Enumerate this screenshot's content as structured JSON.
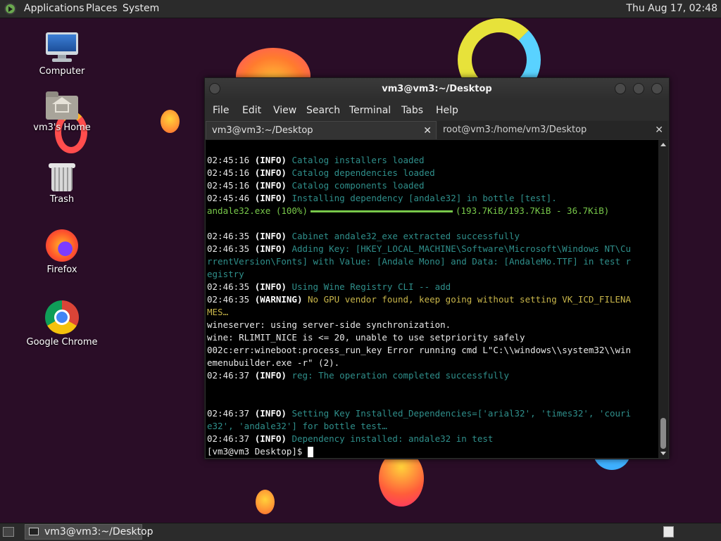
{
  "top_panel": {
    "menus": [
      "Applications",
      "Places",
      "System"
    ],
    "clock": "Thu Aug 17, 02:48"
  },
  "desktop": {
    "icons": [
      {
        "label": "Computer",
        "icon": "computer-icon"
      },
      {
        "label": "vm3's Home",
        "icon": "home-folder-icon"
      },
      {
        "label": "Trash",
        "icon": "trash-icon"
      },
      {
        "label": "Firefox",
        "icon": "firefox-icon"
      },
      {
        "label": "Google Chrome",
        "icon": "chrome-icon"
      }
    ]
  },
  "terminal": {
    "title": "vm3@vm3:~/Desktop",
    "menu": [
      "File",
      "Edit",
      "View",
      "Search",
      "Terminal",
      "Tabs",
      "Help"
    ],
    "tabs": [
      {
        "label": "vm3@vm3:~/Desktop",
        "active": true
      },
      {
        "label": "root@vm3:/home/vm3/Desktop",
        "active": false
      }
    ],
    "lines": [
      {
        "ts": "02:45:16",
        "lvl": "(INFO)",
        "msg": "Catalog installers loaded"
      },
      {
        "ts": "02:45:16",
        "lvl": "(INFO)",
        "msg": "Catalog dependencies loaded"
      },
      {
        "ts": "02:45:16",
        "lvl": "(INFO)",
        "msg": "Catalog components loaded"
      },
      {
        "ts": "02:45:46",
        "lvl": "(INFO)",
        "msg": "Installing dependency [andale32] in bottle [test]."
      },
      {
        "progress_file": "andale32.exe (100%)",
        "progress_stats": "(193.7KiB/193.7KiB - 36.7KiB)"
      },
      {
        "blank": ""
      },
      {
        "ts": "02:46:35",
        "lvl": "(INFO)",
        "msg": "Cabinet andale32_exe extracted successfully"
      },
      {
        "ts": "02:46:35",
        "lvl": "(INFO)",
        "msg": "Adding Key: [HKEY_LOCAL_MACHINE\\Software\\Microsoft\\Windows NT\\Cu"
      },
      {
        "cont": "rrentVersion\\Fonts] with Value: [Andale Mono] and Data: [AndaleMo.TTF] in test r"
      },
      {
        "cont": "egistry"
      },
      {
        "ts": "02:46:35",
        "lvl": "(INFO)",
        "msg": "Using Wine Registry CLI -- add"
      },
      {
        "ts": "02:46:35",
        "warnlvl": "(WARNING)",
        "warnmsg": "No GPU vendor found, keep going without setting VK_ICD_FILENA"
      },
      {
        "warncont": "MES…"
      },
      {
        "plain": "wineserver: using server-side synchronization."
      },
      {
        "plain": "wine: RLIMIT_NICE is <= 20, unable to use setpriority safely"
      },
      {
        "plain": "002c:err:wineboot:process_run_key Error running cmd L\"C:\\\\windows\\\\system32\\\\win"
      },
      {
        "plain": "emenubuilder.exe -r\" (2)."
      },
      {
        "ts": "02:46:37",
        "lvl": "(INFO)",
        "msg": "reg: The operation completed successfully"
      },
      {
        "blank": ""
      },
      {
        "blank": ""
      },
      {
        "ts": "02:46:37",
        "lvl": "(INFO)",
        "msg": "Setting Key Installed_Dependencies=['arial32', 'times32', 'couri"
      },
      {
        "cont": "e32', 'andale32'] for bottle test…"
      },
      {
        "ts": "02:46:37",
        "lvl": "(INFO)",
        "msg": "Dependency installed: andale32 in test"
      },
      {
        "prompt": "[vm3@vm3 Desktop]$ "
      }
    ],
    "colors": {
      "info_msg": "#2f8f8b",
      "warning": "#c9b64a",
      "progress": "#78c84a"
    }
  },
  "bottom_panel": {
    "task_label": "vm3@vm3:~/Desktop"
  }
}
